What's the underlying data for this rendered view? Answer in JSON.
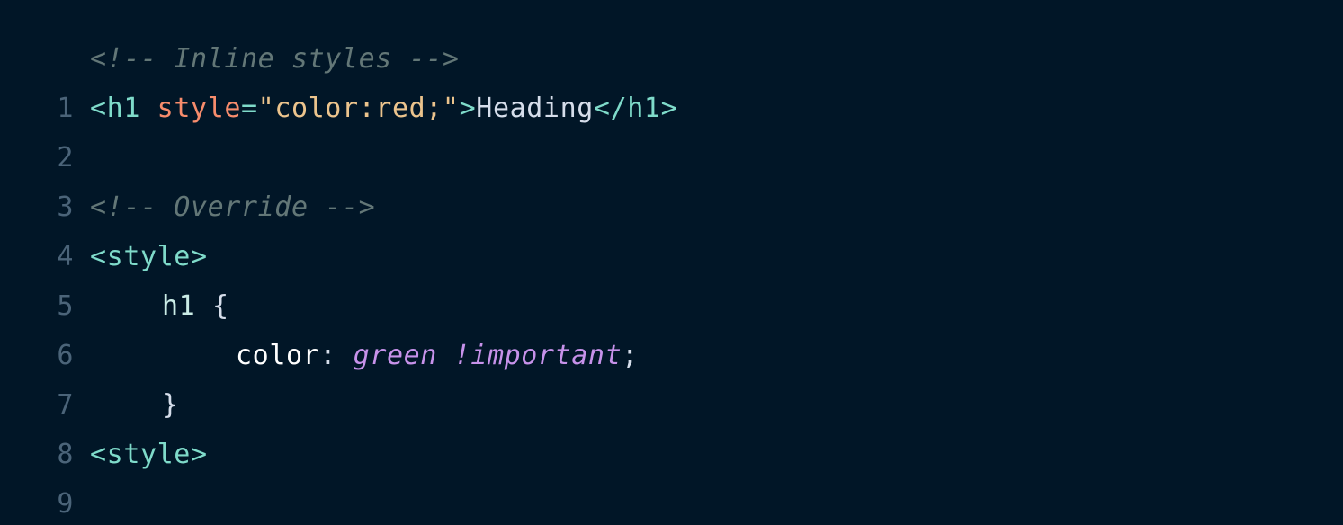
{
  "editor": {
    "theme_background": "#011627",
    "colors": {
      "comment": "#637777",
      "tag": "#7fdbca",
      "attribute": "#f78c6c",
      "string": "#ecc48d",
      "text": "#d6deeb",
      "value": "#c792ea",
      "line_number": "#4b6479"
    },
    "lines": [
      {
        "number": "1",
        "comment": "<!-- Inline styles -->"
      },
      {
        "number": "2",
        "open_tag": "<h1",
        "attr_name": "style",
        "equals": "=",
        "attr_value": "\"color:red;\"",
        "tag_close": ">",
        "text": "Heading",
        "end_tag": "</h1>"
      },
      {
        "number": "3"
      },
      {
        "number": "4",
        "comment": "<!-- Override -->"
      },
      {
        "number": "5",
        "tag": "<style>"
      },
      {
        "number": "6",
        "selector": "h1",
        "brace": "{"
      },
      {
        "number": "7",
        "property": "color",
        "colon": ":",
        "value": "green !important",
        "semicolon": ";"
      },
      {
        "number": "8",
        "brace": "}"
      },
      {
        "number": "9",
        "tag": "<style>"
      }
    ]
  }
}
